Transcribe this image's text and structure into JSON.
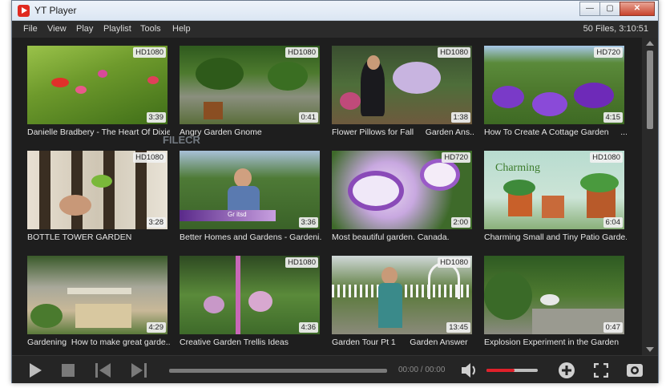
{
  "window": {
    "title": "YT Player"
  },
  "menu": [
    "File",
    "View",
    "Play",
    "Playlist",
    "Tools",
    "Help"
  ],
  "status": {
    "file_count": "50 Files, 3:10:51"
  },
  "videos": [
    {
      "title": "Danielle Bradbery - The Heart Of Dixie",
      "badge": "HD1080",
      "duration": "3:39"
    },
    {
      "title": "Angry Garden Gnome",
      "badge": "HD1080",
      "duration": "0:41"
    },
    {
      "title": "Flower Pillows for Fall     Garden Ans...",
      "badge": "HD1080",
      "duration": "1:38"
    },
    {
      "title": "How To Create A Cottage Garden     ...",
      "badge": "HD720",
      "duration": "4:15"
    },
    {
      "title": "BOTTLE TOWER GARDEN",
      "badge": "HD1080",
      "duration": "3:28"
    },
    {
      "title": "Better Homes and Gardens - Gardeni...",
      "badge": "",
      "duration": "3:36",
      "overlay": "Gr itsd"
    },
    {
      "title": "Most beautiful garden. Canada.",
      "badge": "HD720",
      "duration": "2:00"
    },
    {
      "title": "Charming Small and Tiny Patio Garde...",
      "badge": "HD1080",
      "duration": "6:04",
      "overlay": "Charming"
    },
    {
      "title": "Gardening  How to make great garde...",
      "badge": "",
      "duration": "4:29"
    },
    {
      "title": "Creative Garden Trellis Ideas",
      "badge": "HD1080",
      "duration": "4:36"
    },
    {
      "title": "Garden Tour Pt 1      Garden Answer",
      "badge": "HD1080",
      "duration": "13:45"
    },
    {
      "title": "Explosion Experiment in the Garden",
      "badge": "",
      "duration": "0:47"
    }
  ],
  "watermark": "FILECR",
  "player": {
    "time": "00:00 / 00:00",
    "seek_progress": 0,
    "volume": 0.55
  },
  "colors": {
    "accent": "#e0202a",
    "background": "#1e1e1e"
  },
  "icons": {
    "play": "play-icon",
    "stop": "stop-icon",
    "prev": "previous-icon",
    "next": "next-icon",
    "volume": "volume-icon",
    "add": "add-icon",
    "fullscreen": "fullscreen-icon",
    "view": "eye-icon"
  }
}
